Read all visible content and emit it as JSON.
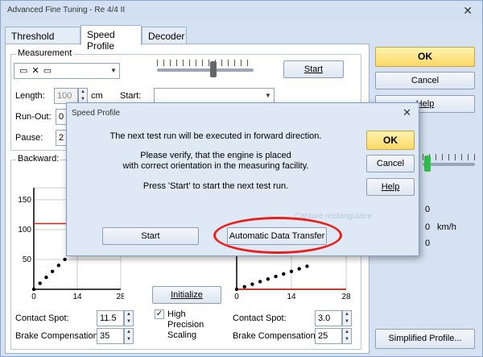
{
  "window": {
    "title": "Advanced Fine Tuning - Re 4/4 II"
  },
  "tabs": [
    {
      "label": "Threshold Speed"
    },
    {
      "label": "Speed Profile"
    },
    {
      "label": "Decoder"
    }
  ],
  "measurement": {
    "group_label": "Measurement",
    "start_button": "Start",
    "length_label": "Length:",
    "length_value": "100",
    "length_unit": "cm",
    "start_label": "Start:",
    "runout_label": "Run-Out:",
    "runout_value": "0",
    "pause_label": "Pause:",
    "pause_value": "2"
  },
  "backward": {
    "label": "Backward:",
    "contact_spot_label": "Contact Spot:",
    "contact_spot_value": "11.5",
    "brake_comp_label": "Brake Compensation:",
    "brake_comp_value": "35"
  },
  "forward": {
    "contact_spot_label": "Contact Spot:",
    "contact_spot_value": "3.0",
    "brake_comp_label": "Brake Compensation:",
    "brake_comp_value": "25"
  },
  "middle": {
    "initialize_button": "Initialize",
    "high_precision_label_1": "High",
    "high_precision_label_2": "Precision",
    "high_precision_label_3": "Scaling",
    "high_precision_checked": "✓"
  },
  "right_panel": {
    "ok_button": "OK",
    "cancel_button": "Cancel",
    "help_button": "Help",
    "readout_1": "0",
    "readout_2": "0",
    "readout_2_unit": "km/h",
    "readout_3": "0",
    "simplified_button": "Simplified Profile..."
  },
  "dialog": {
    "title": "Speed Profile",
    "line1": "The next test run will be executed in forward direction.",
    "line2": "Please verify, that the engine is placed",
    "line3": "with correct orientation in the measuring facility.",
    "line4": "Press 'Start' to start the next test run.",
    "ok_button": "OK",
    "cancel_button": "Cancel",
    "help_button": "Help",
    "start_button": "Start",
    "auto_transfer_button": "Automatic Data Transfer",
    "ghost_text": "Capture rectangulaire"
  },
  "chart_data": [
    {
      "type": "scatter",
      "x": [
        0,
        2,
        4,
        6,
        8,
        10,
        12,
        14
      ],
      "y": [
        0,
        10,
        20,
        30,
        40,
        50,
        60,
        70
      ],
      "xticks": [
        "0",
        "14",
        "28"
      ],
      "yticks": [
        "50",
        "100",
        "150"
      ],
      "xlim": [
        0,
        28
      ],
      "ylim": [
        0,
        170
      ],
      "reference_line": 110,
      "title": "",
      "xlabel": "",
      "ylabel": ""
    },
    {
      "type": "scatter",
      "x": [
        0,
        2,
        4,
        6,
        8,
        10,
        12,
        14,
        16,
        18
      ],
      "y": [
        0,
        10,
        20,
        30,
        40,
        50,
        60,
        70,
        80,
        90
      ],
      "xticks": [
        "0",
        "14",
        "28"
      ],
      "xlim": [
        0,
        28
      ],
      "ylim": [
        0,
        170
      ],
      "reference_line": 0,
      "title": "",
      "xlabel": "",
      "ylabel": ""
    }
  ]
}
